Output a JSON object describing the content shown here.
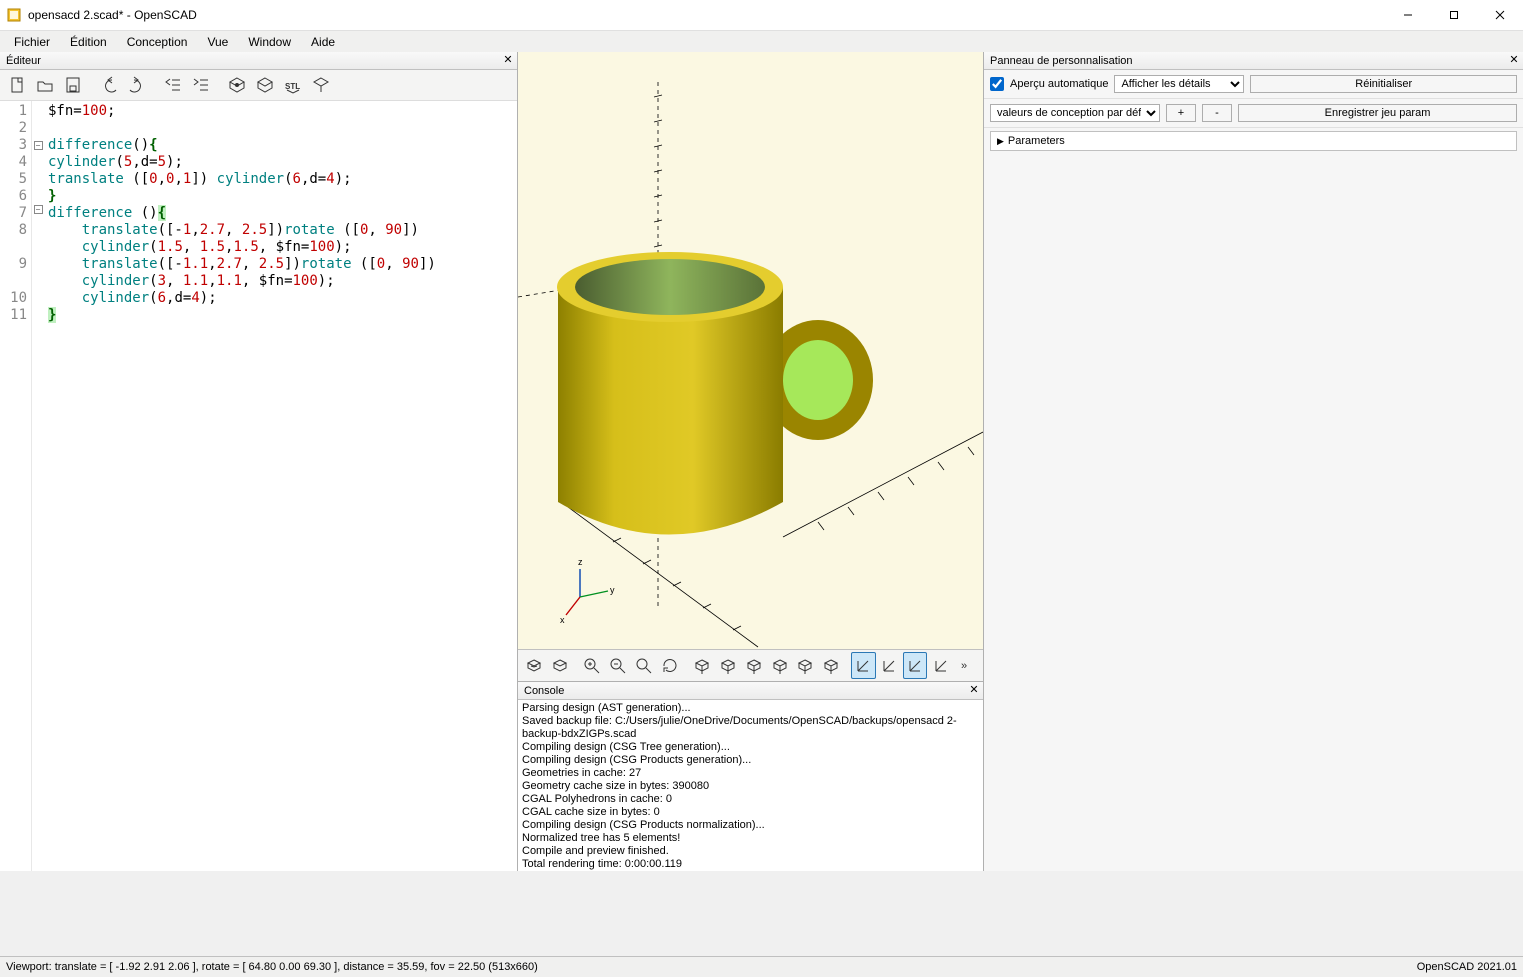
{
  "titlebar": {
    "title": "opensacd 2.scad* - OpenSCAD"
  },
  "menubar": [
    "Fichier",
    "Édition",
    "Conception",
    "Vue",
    "Window",
    "Aide"
  ],
  "editor": {
    "header": "Éditeur",
    "lines": [
      {
        "n": 1,
        "html": "$fn=<span class='num'>100</span>;"
      },
      {
        "n": 2,
        "html": ""
      },
      {
        "n": 3,
        "html": "<span class='kw'>difference</span>()<span class='br'>{</span>",
        "fold": true
      },
      {
        "n": 4,
        "html": "<span class='kw'>cylinder</span>(<span class='num'>5</span>,d=<span class='num'>5</span>);"
      },
      {
        "n": 5,
        "html": "<span class='kw'>translate</span> ([<span class='num'>0</span>,<span class='num'>0</span>,<span class='num'>1</span>]) <span class='kw'>cylinder</span>(<span class='num'>6</span>,d=<span class='num'>4</span>);"
      },
      {
        "n": 6,
        "html": "<span class='br'>}</span>"
      },
      {
        "n": 7,
        "html": "<span class='kw'>difference</span> ()<span class='br hl'>{</span>",
        "fold": true
      },
      {
        "n": 8,
        "html": "    <span class='kw'>translate</span>([-<span class='num'>1</span>,<span class='num'>2.7</span>, <span class='num'>2.5</span>])<span class='kw'>rotate</span> ([<span class='num'>0</span>, <span class='num'>90</span>])\n    <span class='kw'>cylinder</span>(<span class='num'>1.5</span>, <span class='num'>1.5</span>,<span class='num'>1.5</span>, $fn=<span class='num'>100</span>);"
      },
      {
        "n": 9,
        "html": "    <span class='kw'>translate</span>([-<span class='num'>1.1</span>,<span class='num'>2.7</span>, <span class='num'>2.5</span>])<span class='kw'>rotate</span> ([<span class='num'>0</span>, <span class='num'>90</span>])\n    <span class='kw'>cylinder</span>(<span class='num'>3</span>, <span class='num'>1.1</span>,<span class='num'>1.1</span>, $fn=<span class='num'>100</span>);"
      },
      {
        "n": 10,
        "html": "    <span class='kw'>cylinder</span>(<span class='num'>6</span>,d=<span class='num'>4</span>);"
      },
      {
        "n": 11,
        "html": "<span class='br hl'>}</span>"
      }
    ]
  },
  "console": {
    "header": "Console",
    "lines": [
      "Parsing design (AST generation)...",
      "Saved backup file: C:/Users/julie/OneDrive/Documents/OpenSCAD/backups/opensacd 2-backup-bdxZIGPs.scad",
      "Compiling design (CSG Tree generation)...",
      "Compiling design (CSG Products generation)...",
      "Geometries in cache: 27",
      "Geometry cache size in bytes: 390080",
      "CGAL Polyhedrons in cache: 0",
      "CGAL cache size in bytes: 0",
      "Compiling design (CSG Products normalization)...",
      "Normalized tree has 5 elements!",
      "Compile and preview finished.",
      "Total rendering time: 0:00:00.119"
    ]
  },
  "customizer": {
    "header": "Panneau de personnalisation",
    "auto_preview": "Aperçu automatique",
    "detail_select": "Afficher les détails",
    "reset": "Réinitialiser",
    "preset_select": "valeurs de conception par défaut",
    "plus": "+",
    "minus": "-",
    "save_preset": "Enregistrer jeu param",
    "parameters": "Parameters"
  },
  "statusbar": {
    "left": "Viewport: translate = [ -1.92 2.91 2.06 ], rotate = [ 64.80 0.00 69.30 ], distance = 35.59, fov = 22.50 (513x660)",
    "right": "OpenSCAD 2021.01"
  },
  "icons": {
    "editor_tb": [
      "new",
      "open",
      "save",
      "undo",
      "redo",
      "unindent",
      "indent",
      "preview",
      "render",
      "stl",
      "print"
    ],
    "view_tb": [
      "preview",
      "render",
      "zoom-in",
      "zoom-out",
      "zoom-fit",
      "reset-view",
      "right",
      "top",
      "bottom",
      "left",
      "front",
      "back",
      "perspective",
      "ortho",
      "surface",
      "wireframe",
      "more"
    ]
  }
}
